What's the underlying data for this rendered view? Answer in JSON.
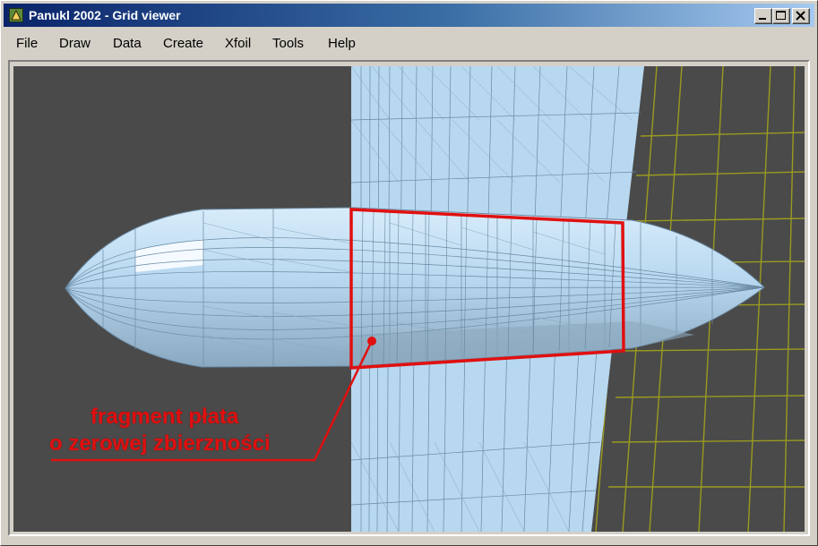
{
  "window": {
    "title": "Panukl 2002 - Grid viewer"
  },
  "menu": {
    "items": [
      "File",
      "Draw",
      "Data",
      "Create",
      "Xfoil",
      "Tools",
      "Help"
    ]
  },
  "annotation": {
    "line1": "fragment płata",
    "line2": "o zerowej zbierzności"
  },
  "icons": {
    "app": "app-icon",
    "minimize": "minimize-icon",
    "maximize": "maximize-icon",
    "close": "close-icon"
  },
  "colors": {
    "viewport_background": "#4a4a4a",
    "mesh_fill": "#b8d8f0",
    "mesh_lines": "#6a8aa4",
    "wireframe": "#9a9a20",
    "annotation": "#e01010"
  }
}
